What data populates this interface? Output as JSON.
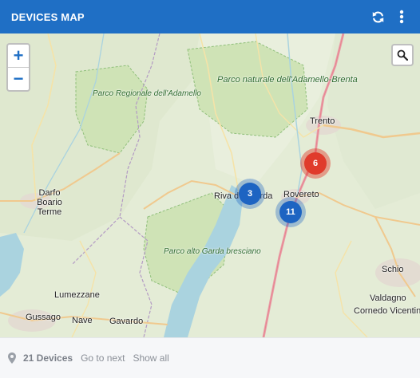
{
  "header": {
    "title": "DEVICES MAP",
    "refresh_icon": "refresh-icon",
    "menu_icon": "more-vertical-icon",
    "bg_color": "#1f6fc5"
  },
  "map": {
    "zoom_in": "+",
    "zoom_out": "−",
    "search_icon": "search-icon",
    "labels": {
      "parco_regionale": "Parco Regionale dell'Adamello",
      "parco_naturale": "Parco naturale dell'Adamello-Brenta",
      "parco_alto_garda": "Parco alto Garda bresciano",
      "trento": "Trento",
      "rovereto": "Rovereto",
      "riva": "Riva del Garda",
      "darfo": "Darfo Boario Terme",
      "lumezzane": "Lumezzane",
      "gussago": "Gussago",
      "nave": "Nave",
      "gavardo": "Gavardo",
      "schio": "Schio",
      "valdagno": "Valdagno",
      "cornedo": "Cornedo Vicentino"
    },
    "clusters": [
      {
        "count": "3",
        "color": "#1d64c2"
      },
      {
        "count": "11",
        "color": "#1d64c2"
      },
      {
        "count": "6",
        "color": "#e03b2c"
      }
    ]
  },
  "footer": {
    "pin_icon": "map-pin-icon",
    "device_count": "21 Devices",
    "go_to_next": "Go to next",
    "show_all": "Show all"
  }
}
